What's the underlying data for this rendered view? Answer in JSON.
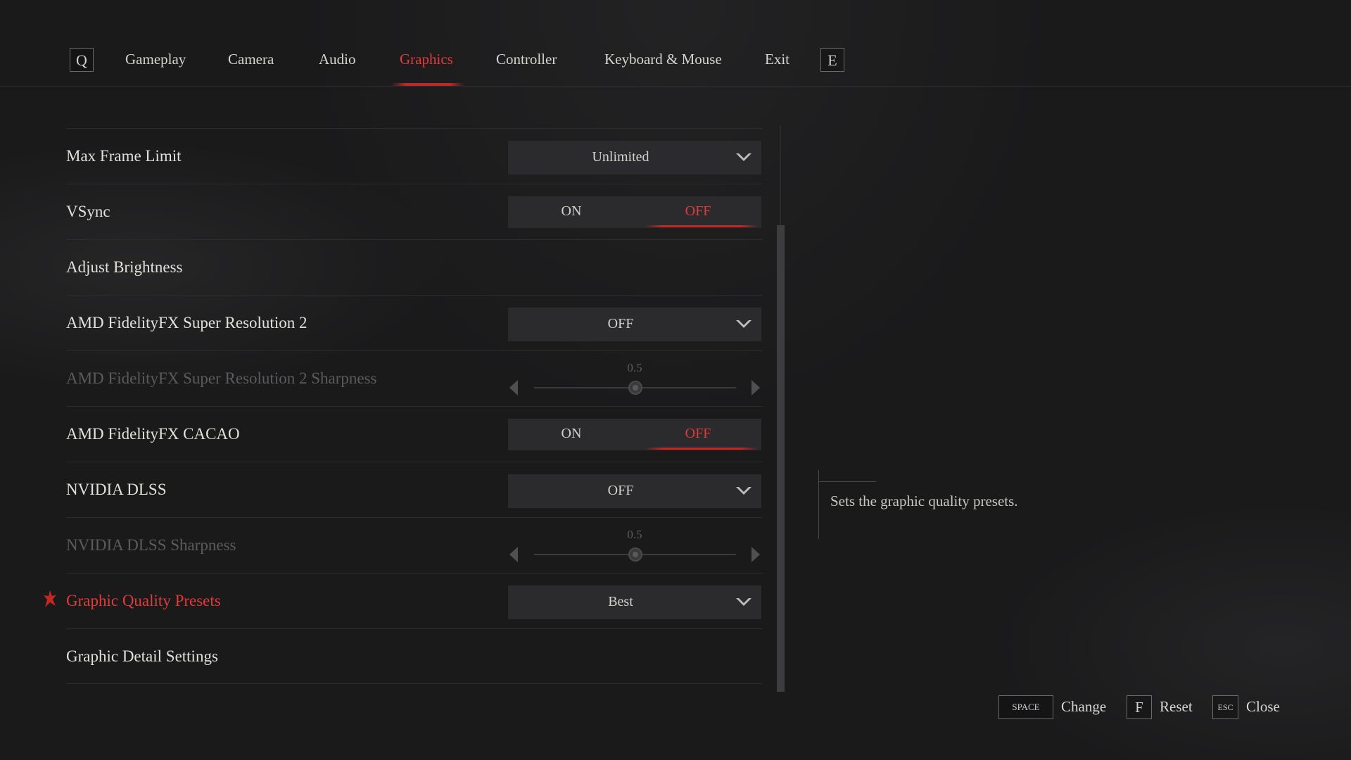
{
  "nav": {
    "prev_key": "Q",
    "next_key": "E",
    "tabs": [
      {
        "label": "Gameplay"
      },
      {
        "label": "Camera"
      },
      {
        "label": "Audio"
      },
      {
        "label": "Graphics"
      },
      {
        "label": "Controller"
      },
      {
        "label": "Keyboard & Mouse"
      },
      {
        "label": "Exit"
      }
    ],
    "active_tab": "Graphics"
  },
  "settings": [
    {
      "label": "Max Frame Limit",
      "control": "dropdown",
      "value": "Unlimited"
    },
    {
      "label": "VSync",
      "control": "toggle",
      "on_label": "ON",
      "off_label": "OFF",
      "selected": "OFF"
    },
    {
      "label": "Adjust Brightness",
      "control": "none"
    },
    {
      "label": "AMD FidelityFX Super Resolution 2",
      "control": "dropdown",
      "value": "OFF"
    },
    {
      "label": "AMD FidelityFX Super Resolution 2 Sharpness",
      "control": "slider",
      "value_text": "0.5",
      "value": 0.5,
      "disabled": true
    },
    {
      "label": "AMD FidelityFX CACAO",
      "control": "toggle",
      "on_label": "ON",
      "off_label": "OFF",
      "selected": "OFF"
    },
    {
      "label": "NVIDIA DLSS",
      "control": "dropdown",
      "value": "OFF"
    },
    {
      "label": "NVIDIA DLSS Sharpness",
      "control": "slider",
      "value_text": "0.5",
      "value": 0.5,
      "disabled": true
    },
    {
      "label": "Graphic Quality Presets",
      "control": "dropdown",
      "value": "Best",
      "selected": true
    },
    {
      "label": "Graphic Detail Settings",
      "control": "none"
    }
  ],
  "description": "Sets the graphic quality presets.",
  "hints": [
    {
      "key": "SPACE",
      "label": "Change"
    },
    {
      "key": "F",
      "label": "Reset"
    },
    {
      "key": "ESC",
      "label": "Close"
    }
  ],
  "colors": {
    "accent": "#e23a3a",
    "background": "#1a1a1b",
    "control_bg": "#2b2b2d",
    "text": "#e2e0dc",
    "disabled_text": "#5b5b5d"
  }
}
